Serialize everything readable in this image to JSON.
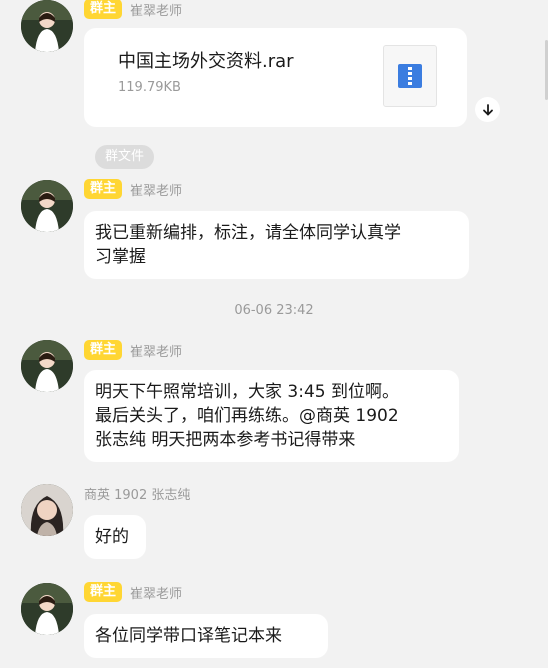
{
  "messages": [
    {
      "role_badge": "群主",
      "sender": "崔翠老师",
      "file": {
        "name": "中国主场外交资料.rar",
        "size": "119.79KB",
        "icon": "zip-file-icon"
      }
    },
    {
      "tag": "群文件"
    },
    {
      "role_badge": "群主",
      "sender": "崔翠老师",
      "text_line1": "我已重新编排，标注，请全体同学认真学",
      "text_line2": "习掌握"
    },
    {
      "timestamp": "06-06 23:42"
    },
    {
      "role_badge": "群主",
      "sender": "崔翠老师",
      "text_line1": "明天下午照常培训，大家 3:45 到位啊。",
      "text_line2": "最后关头了，咱们再练练。@商英 1902",
      "text_line3": "张志纯 明天把两本参考书记得带来"
    },
    {
      "sender": "商英 1902 张志纯",
      "text": "好的"
    },
    {
      "role_badge": "群主",
      "sender": "崔翠老师",
      "text": "各位同学带口译笔记本来"
    }
  ],
  "colors": {
    "badge": "#ffd633",
    "background": "#f2f2f2",
    "bubble": "#ffffff",
    "muted": "#9a9a9a"
  }
}
